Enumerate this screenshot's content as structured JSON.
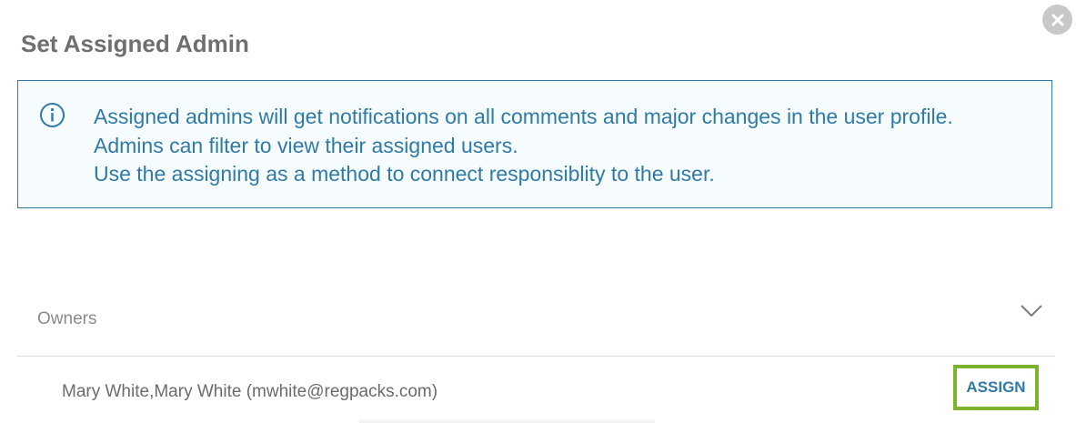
{
  "dialog": {
    "title": "Set Assigned Admin",
    "close_icon": "close-icon"
  },
  "info": {
    "icon": "info-icon",
    "lines": [
      "Assigned admins will get notifications on all comments and major changes in the user profile.",
      "Admins can filter to view their assigned users.",
      "Use the assigning as a method to connect responsiblity to the user."
    ]
  },
  "owners": {
    "label": "Owners",
    "toggle_icon": "chevron-down-icon",
    "items": [
      {
        "name": "Mary White,Mary White (mwhite@regpacks.com)",
        "action_label": "ASSIGN"
      }
    ]
  },
  "colors": {
    "accent_blue": "#2f7ba6",
    "info_background": "#f6fbfe",
    "assign_border_green": "#7db32c",
    "close_button_gray": "#c8c8c8"
  }
}
